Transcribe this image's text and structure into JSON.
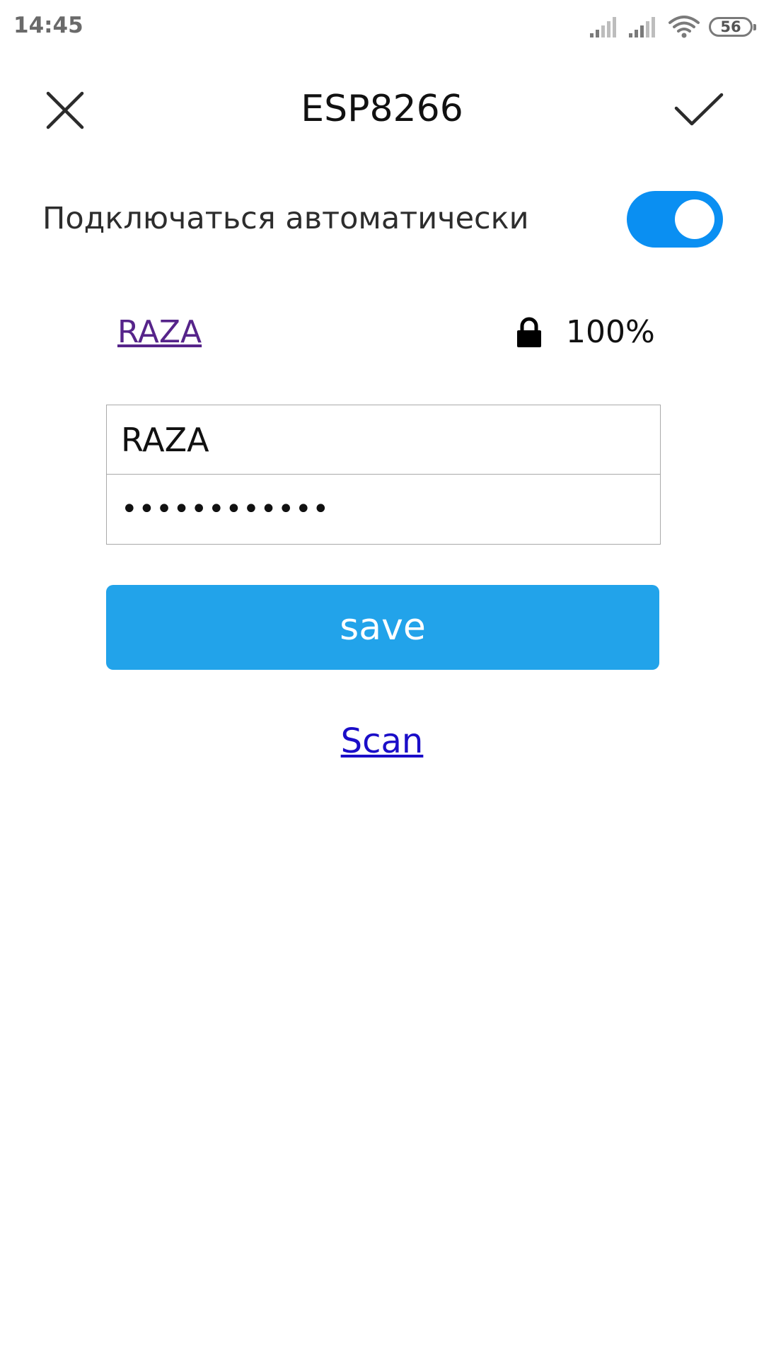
{
  "status_bar": {
    "time": "14:45",
    "battery": "56",
    "icons": [
      "signal-icon",
      "signal-icon",
      "wifi-icon",
      "battery-icon"
    ]
  },
  "header": {
    "title": "ESP8266",
    "close_icon": "close-icon",
    "confirm_icon": "check-icon"
  },
  "auto_connect": {
    "label": "Подключаться автоматически",
    "enabled": true
  },
  "network": {
    "name": "RAZA",
    "secured_icon": "lock-icon",
    "signal": "100%"
  },
  "form": {
    "ssid_value": "RAZA",
    "password_value": "••••••••••••"
  },
  "actions": {
    "save_label": "save",
    "scan_label": "Scan"
  },
  "colors": {
    "toggle_on": "#0a8ff2",
    "save_button": "#22a3ea",
    "visited_link": "#56248a",
    "link": "#1a0dc8"
  }
}
